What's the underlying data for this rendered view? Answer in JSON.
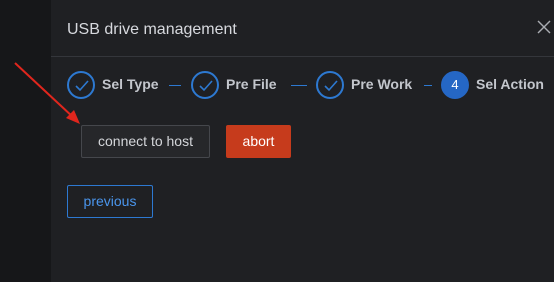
{
  "dialog": {
    "title": "USB drive management",
    "close_icon": "close-icon"
  },
  "steps": [
    {
      "label": "Sel Type",
      "state": "done",
      "icon": "check-icon"
    },
    {
      "label": "Pre File",
      "state": "done",
      "icon": "check-icon"
    },
    {
      "label": "Pre Work",
      "state": "done",
      "icon": "check-icon"
    },
    {
      "label": "Sel Action",
      "state": "active",
      "number": "4"
    }
  ],
  "actions": {
    "connect_label": "connect to host",
    "abort_label": "abort"
  },
  "footer": {
    "previous_label": "previous"
  },
  "colors": {
    "accent": "#2d79d1",
    "danger": "#c63b1c",
    "annotation_arrow": "#e0261d"
  }
}
